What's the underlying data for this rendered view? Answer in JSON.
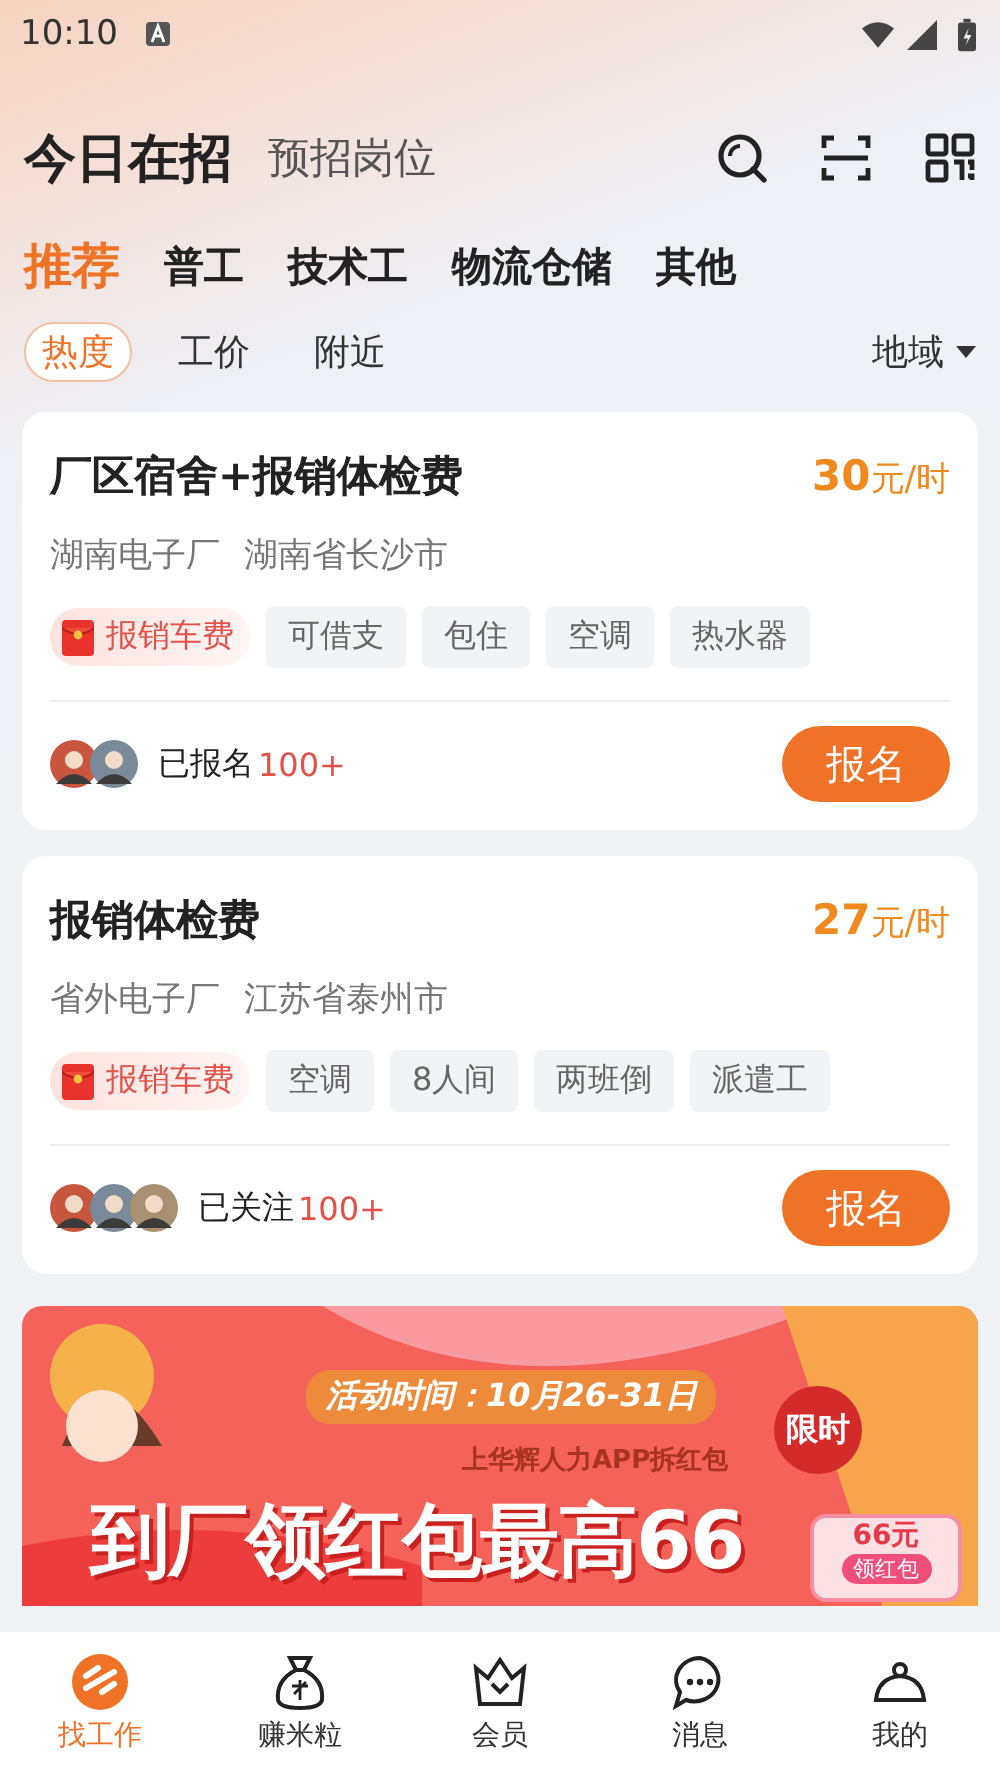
{
  "status_bar": {
    "time": "10:10"
  },
  "header": {
    "title": "今日在招",
    "subtitle": "预招岗位"
  },
  "categories": [
    {
      "label": "推荐",
      "selected": true
    },
    {
      "label": "普工",
      "selected": false
    },
    {
      "label": "技术工",
      "selected": false
    },
    {
      "label": "物流仓储",
      "selected": false
    },
    {
      "label": "其他",
      "selected": false
    }
  ],
  "sorts": [
    {
      "label": "热度",
      "selected": true
    },
    {
      "label": "工价",
      "selected": false
    },
    {
      "label": "附近",
      "selected": false
    }
  ],
  "region_filter": "地域",
  "jobs": [
    {
      "title": "厂区宿舍+报销体检费",
      "wage_amount": "30",
      "wage_unit": "元/时",
      "company": "湖南电子厂",
      "location": "湖南省长沙市",
      "bonus_tag": "报销车费",
      "tags": [
        "可借支",
        "包住",
        "空调",
        "热水器"
      ],
      "avatars": [
        {
          "kind": "picture"
        },
        {
          "kind": "picture"
        }
      ],
      "activity_label": "已报名",
      "count": "100+",
      "button": "报名"
    },
    {
      "title": "报销体检费",
      "wage_amount": "27",
      "wage_unit": "元/时",
      "company": "省外电子厂",
      "location": "江苏省泰州市",
      "bonus_tag": "报销车费",
      "tags": [
        "空调",
        "8人间",
        "两班倒",
        "派遣工"
      ],
      "avatars": [
        {
          "kind": "picture"
        },
        {
          "kind": "picture"
        },
        {
          "kind": "picture"
        }
      ],
      "activity_label": "已关注",
      "count": "100+",
      "button": "报名"
    }
  ],
  "banner": {
    "date_text": "活动时间：10月26-31日",
    "limited_badge": "限时",
    "subline": "上华辉人力APP拆红包",
    "headline": "到厂领红包最高66"
  },
  "floating_reward": {
    "amount": "66元",
    "button": "领红包"
  },
  "nav": [
    {
      "label": "找工作",
      "selected": true
    },
    {
      "label": "赚米粒",
      "selected": false
    },
    {
      "label": "会员",
      "selected": false
    },
    {
      "label": "消息",
      "selected": false
    },
    {
      "label": "我的",
      "selected": false
    }
  ]
}
